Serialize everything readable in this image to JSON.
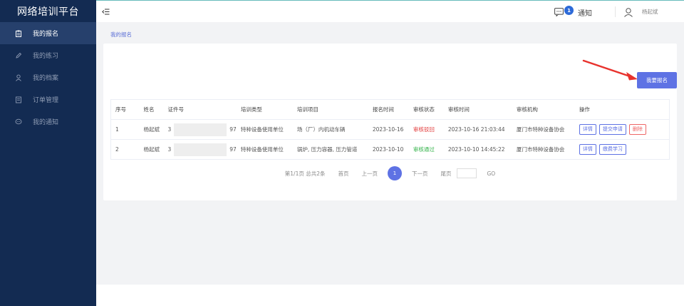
{
  "app": {
    "title": "网络培训平台"
  },
  "sidebar": {
    "items": [
      {
        "label": "我的报名",
        "icon": "clipboard-icon",
        "active": true
      },
      {
        "label": "我的练习",
        "icon": "pencil-icon",
        "active": false
      },
      {
        "label": "我的档案",
        "icon": "user-icon",
        "active": false
      },
      {
        "label": "订单管理",
        "icon": "document-icon",
        "active": false
      },
      {
        "label": "我的通知",
        "icon": "chat-icon",
        "active": false
      }
    ]
  },
  "topbar": {
    "notify_label": "通知",
    "notify_count": "1",
    "user_name": "杨起斌"
  },
  "breadcrumb": "我的报名",
  "apply_button": "我要报名",
  "table": {
    "headers": [
      "序号",
      "姓名",
      "证件号",
      "培训类型",
      "培训项目",
      "报名时间",
      "审核状态",
      "审核时间",
      "审核机构",
      "操作"
    ],
    "rows": [
      {
        "index": "1",
        "name": "杨起斌",
        "id_prefix": "3",
        "id_suffix": "97",
        "type": "特种设备使用单位",
        "project": "场（厂）内机动车辆",
        "apply_date": "2023-10-16",
        "status": "审核驳回",
        "review_time": "2023-10-16 21:03:44",
        "org": "厦门市特种设备协会",
        "ops": [
          "详情",
          "提交申请",
          "删除"
        ]
      },
      {
        "index": "2",
        "name": "杨起斌",
        "id_prefix": "3",
        "id_suffix": "97",
        "type": "特种设备使用单位",
        "project": "锅炉, 压力容器, 压力管道",
        "apply_date": "2023-10-10",
        "status": "审核通过",
        "review_time": "2023-10-10 14:45:22",
        "org": "厦门市特种设备协会",
        "ops": [
          "详情",
          "缴费学习"
        ]
      }
    ]
  },
  "pager": {
    "summary": "第1/1页 总共2条",
    "first": "首页",
    "prev": "上一页",
    "current": "1",
    "next": "下一页",
    "last": "尾页",
    "go": "GO"
  },
  "colors": {
    "sidebar": "#132b52",
    "accent": "#5e72e4",
    "rejected": "#e23b3b",
    "passed": "#33b34a"
  }
}
